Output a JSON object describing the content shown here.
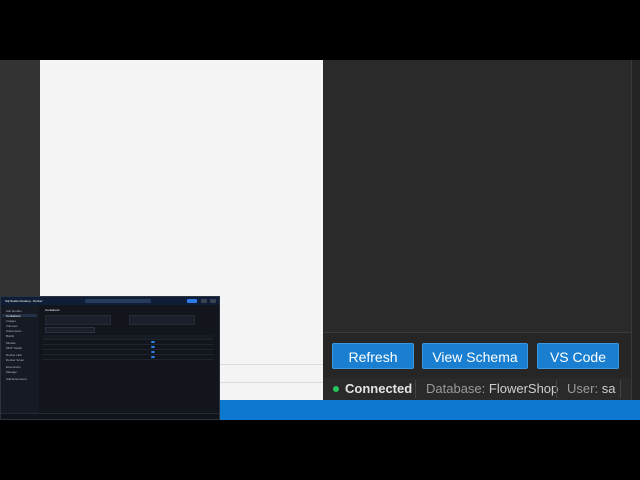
{
  "toolbar": {
    "refresh_label": "Refresh",
    "view_schema_label": "View Schema",
    "vs_code_label": "VS Code"
  },
  "status": {
    "connection": "Connected",
    "database_label": "Database:",
    "database_value": "FlowerShop",
    "user_label": "User:",
    "user_value": "sa",
    "connected_color": "#22c55e"
  },
  "thumbnail": {
    "app_title": "Sql Studio Desktop - Docker",
    "page_title": "Containers",
    "nav_items": [
      "Ask Gordon",
      "Containers",
      "Images",
      "Volumes",
      "Kubernetes",
      "Builds",
      "Models",
      "MCP Toolkit",
      "Docker Hub",
      "Docker Scout",
      "Extensions",
      "Manage",
      "Add Extensions"
    ]
  },
  "colors": {
    "accent": "#1a7fd0",
    "status_bar": "#0d78d0"
  }
}
